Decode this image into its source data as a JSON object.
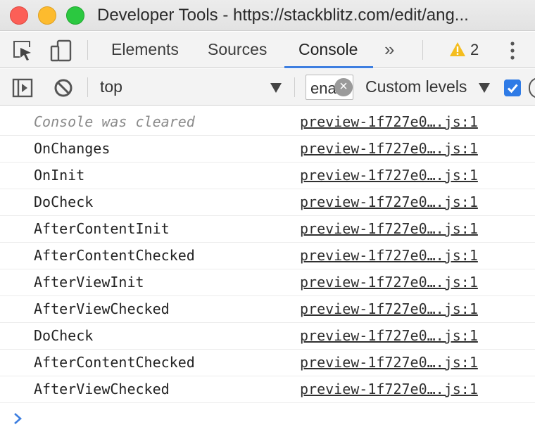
{
  "window": {
    "title": "Developer Tools - https://stackblitz.com/edit/ang..."
  },
  "tabs": [
    {
      "label": "Elements",
      "active": false
    },
    {
      "label": "Sources",
      "active": false
    },
    {
      "label": "Console",
      "active": true
    }
  ],
  "more_tabs": "»",
  "warnings": {
    "count": "2",
    "icon": "warning-icon"
  },
  "console_toolbar": {
    "context": "top",
    "filter_value": "ena",
    "levels_label": "Custom levels"
  },
  "messages": [
    {
      "text": "Console was cleared",
      "source": "preview-1f727e0….js:1",
      "kind": "info"
    },
    {
      "text": "OnChanges",
      "source": "preview-1f727e0….js:1",
      "kind": "log"
    },
    {
      "text": "OnInit",
      "source": "preview-1f727e0….js:1",
      "kind": "log"
    },
    {
      "text": "DoCheck",
      "source": "preview-1f727e0….js:1",
      "kind": "log"
    },
    {
      "text": "AfterContentInit",
      "source": "preview-1f727e0….js:1",
      "kind": "log"
    },
    {
      "text": "AfterContentChecked",
      "source": "preview-1f727e0….js:1",
      "kind": "log"
    },
    {
      "text": "AfterViewInit",
      "source": "preview-1f727e0….js:1",
      "kind": "log"
    },
    {
      "text": "AfterViewChecked",
      "source": "preview-1f727e0….js:1",
      "kind": "log"
    },
    {
      "text": "DoCheck",
      "source": "preview-1f727e0….js:1",
      "kind": "log"
    },
    {
      "text": "AfterContentChecked",
      "source": "preview-1f727e0….js:1",
      "kind": "log"
    },
    {
      "text": "AfterViewChecked",
      "source": "preview-1f727e0….js:1",
      "kind": "log"
    }
  ],
  "colors": {
    "accent": "#3d7ee0",
    "warning": "#f4bd1e",
    "prompt": "#3d7ee0"
  }
}
